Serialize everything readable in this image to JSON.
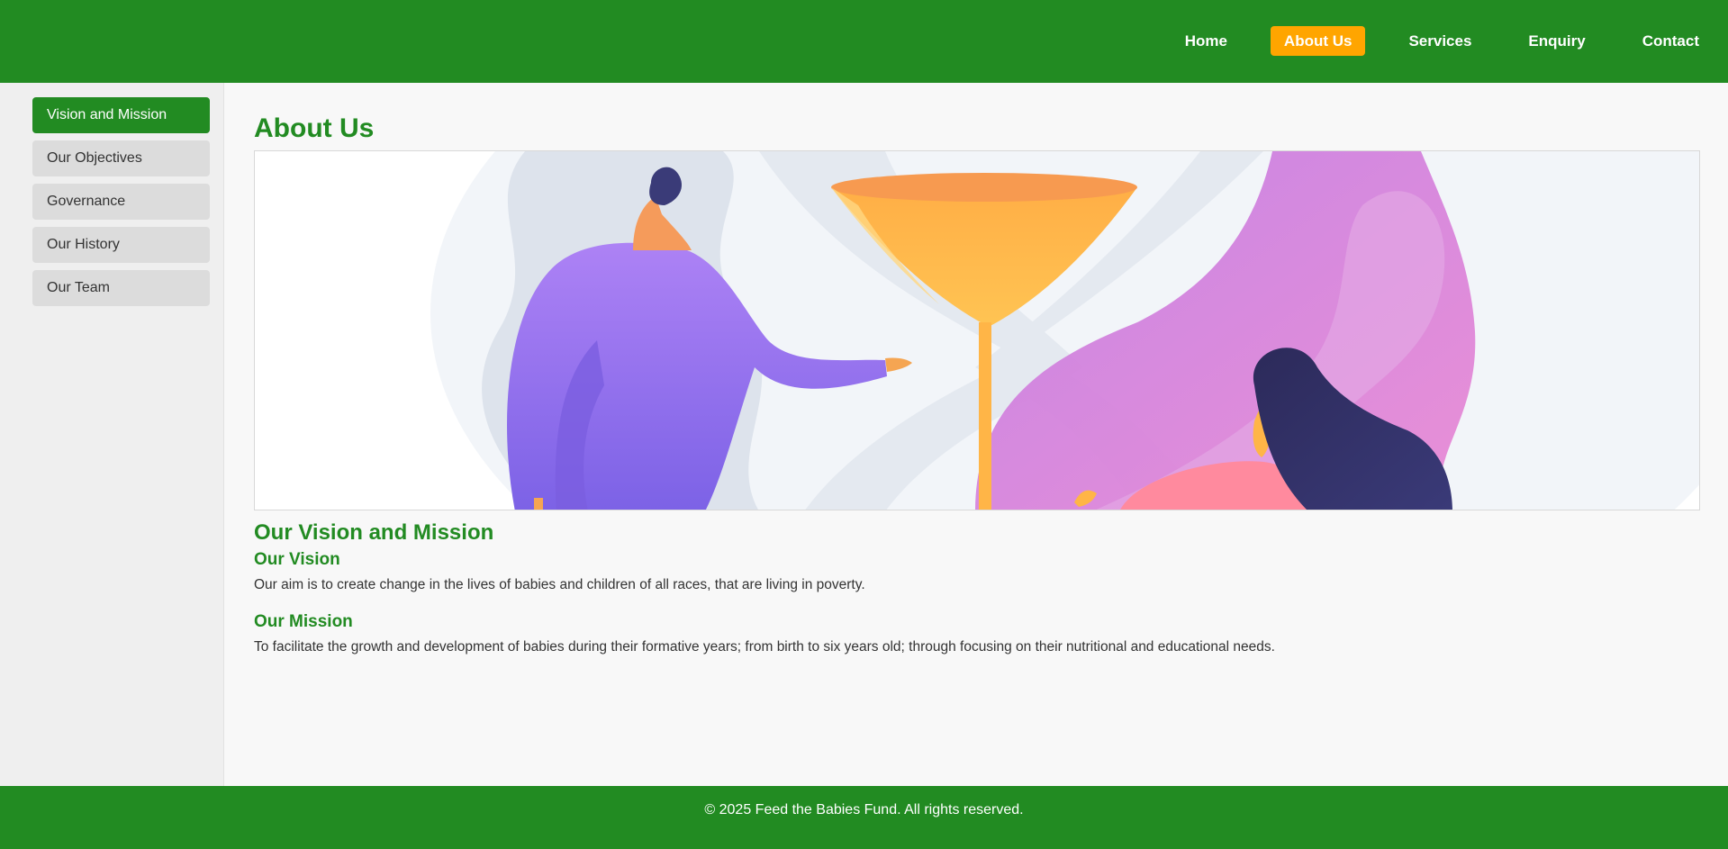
{
  "nav": {
    "items": [
      {
        "label": "Home"
      },
      {
        "label": "About Us"
      },
      {
        "label": "Services"
      },
      {
        "label": "Enquiry"
      },
      {
        "label": "Contact"
      }
    ],
    "active": "About Us"
  },
  "sidebar": {
    "items": [
      {
        "label": "Vision and Mission"
      },
      {
        "label": "Our Objectives"
      },
      {
        "label": "Governance"
      },
      {
        "label": "Our History"
      },
      {
        "label": "Our Team"
      }
    ],
    "active": "Vision and Mission"
  },
  "main": {
    "title": "About Us",
    "section_title": "Our Vision and Mission",
    "vision": {
      "heading": "Our Vision",
      "text": "Our aim is to create change in the lives of babies and children of all races, that are living in poverty."
    },
    "mission": {
      "heading": "Our Mission",
      "text": "To facilitate the growth and development of babies during their formative years; from birth to six years old; through focusing on their nutritional and educational needs."
    }
  },
  "footer": {
    "text": "© 2025 Feed the Babies Fund. All rights reserved."
  },
  "colors": {
    "brand_green": "#228b22",
    "active_orange": "#ffa500",
    "sidebar_bg": "#efefef",
    "sidebar_item_bg": "#dcdcdc"
  }
}
